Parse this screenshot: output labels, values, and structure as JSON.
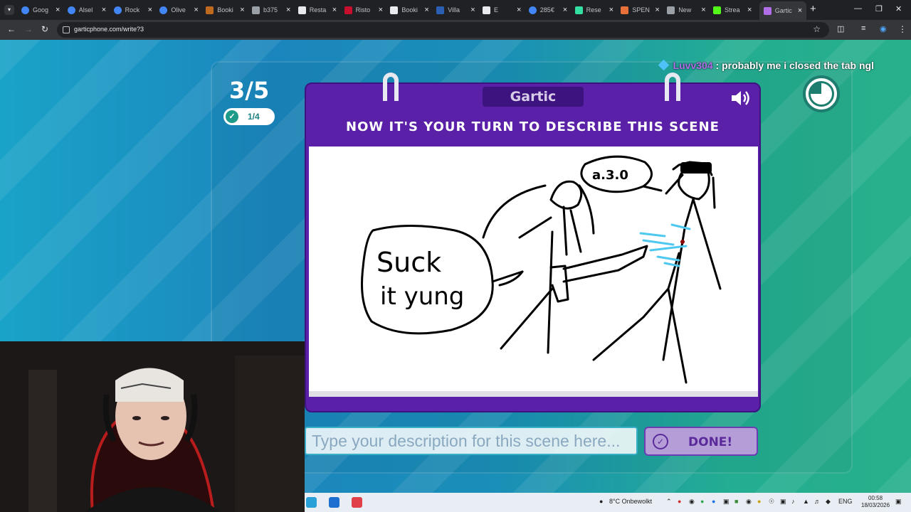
{
  "browser": {
    "tabs": [
      {
        "title": "Goog",
        "favicon": "google-icon",
        "color": "#4285f4"
      },
      {
        "title": "Alsel",
        "favicon": "google-icon",
        "color": "#4285f4"
      },
      {
        "title": "Rock",
        "favicon": "google-icon",
        "color": "#4285f4"
      },
      {
        "title": "Olive",
        "favicon": "google-icon",
        "color": "#4285f4"
      },
      {
        "title": "Booki",
        "favicon": "booking-icon",
        "color": "#c06a20"
      },
      {
        "title": "b375",
        "favicon": "globe-icon",
        "color": "#9aa0a6"
      },
      {
        "title": "Resta",
        "favicon": "document-icon",
        "color": "#e8eaed"
      },
      {
        "title": "Risto",
        "favicon": "restaurant-icon",
        "color": "#c8102e"
      },
      {
        "title": "Booki",
        "favicon": "booking-icon",
        "color": "#e8eaed"
      },
      {
        "title": "Villa",
        "favicon": "flag-icon",
        "color": "#2b5fb4"
      },
      {
        "title": "E",
        "favicon": "e-icon",
        "color": "#e8eaed"
      },
      {
        "title": "285€",
        "favicon": "google-icon",
        "color": "#4285f4"
      },
      {
        "title": "Rese",
        "favicon": "tripadvisor-icon",
        "color": "#34e0a1"
      },
      {
        "title": "SPEN",
        "favicon": "spend-icon",
        "color": "#e8703a"
      },
      {
        "title": "New",
        "favicon": "globe-icon",
        "color": "#9aa0a6"
      },
      {
        "title": "Strea",
        "favicon": "kick-icon",
        "color": "#53fc18"
      },
      {
        "title": "Gartic",
        "favicon": "gartic-icon",
        "color": "#b06ee8"
      }
    ],
    "active_tab": 16,
    "url": "garticphone.com/write?3"
  },
  "game": {
    "round": "3/5",
    "done_count": "1/4",
    "chat": {
      "user": "Luvv304",
      "message": " : probably me i closed the tab ngl"
    },
    "brand": "Gartic",
    "instruction": "NOW IT'S YOUR TURN TO DESCRIBE THIS SCENE",
    "drawing_text": [
      "Suck",
      "it yung"
    ],
    "speech_bubble_text": "a.3.0",
    "input_placeholder": "Type your description for this scene here...",
    "done_button": "DONE!",
    "timer_elapsed_fraction": 0.25,
    "colors": {
      "purple": "#5a20a8",
      "accent_teal": "#1d7d6e",
      "cyan_scribble": "#4fc8f0"
    }
  },
  "taskbar": {
    "weather": "8°C Onbewolkt",
    "language": "ENG",
    "time": "00:58",
    "date": "18/03/2026"
  }
}
